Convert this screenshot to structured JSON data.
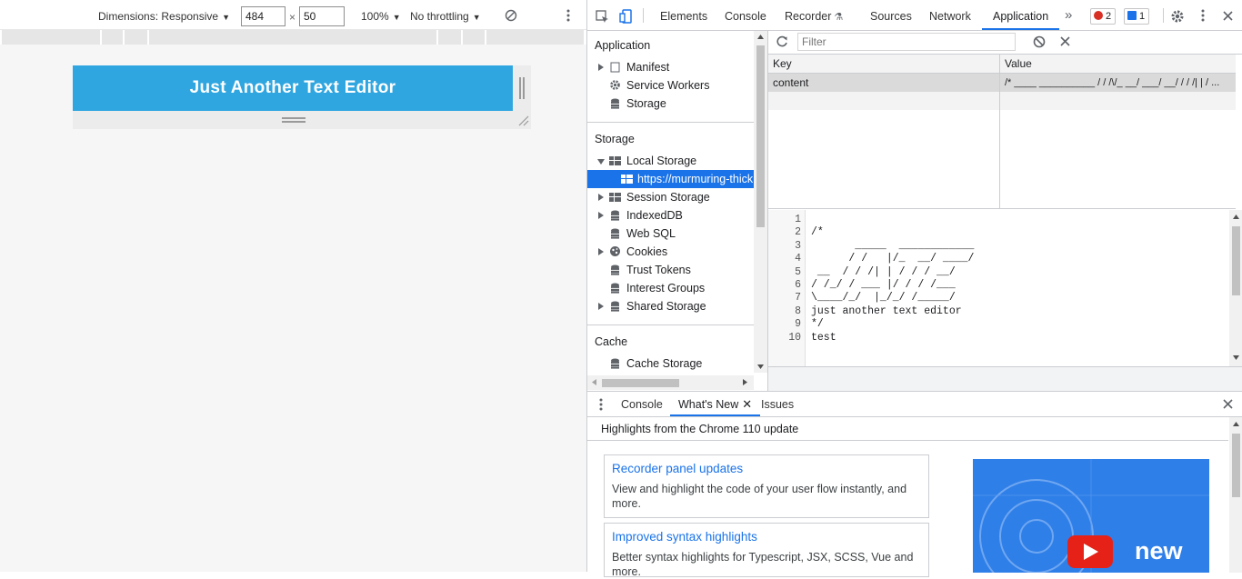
{
  "device_toolbar": {
    "dimensions_label": "Dimensions: Responsive",
    "width_value": "484",
    "times_sign": "×",
    "height_value": "50",
    "zoom_label": "100%",
    "throttle_label": "No throttling"
  },
  "page": {
    "app_title": "Just Another Text Editor",
    "accent_color": "#2fa6e0"
  },
  "devtools": {
    "tabs": [
      "Elements",
      "Console",
      "Recorder",
      "Sources",
      "Network",
      "Application"
    ],
    "active_tab": "Application",
    "more_tabs_glyph": "»",
    "error_count": "2",
    "message_count": "1",
    "sidebar": {
      "application_section": "Application",
      "application_items": [
        "Manifest",
        "Service Workers",
        "Storage"
      ],
      "storage_section": "Storage",
      "local_storage": "Local Storage",
      "local_storage_origin": "https://murmuring-thick",
      "storage_items": [
        "Session Storage",
        "IndexedDB",
        "Web SQL",
        "Cookies",
        "Trust Tokens",
        "Interest Groups",
        "Shared Storage"
      ],
      "cache_section": "Cache",
      "cache_items": [
        "Cache Storage"
      ]
    },
    "storage_table": {
      "filter_placeholder": "Filter",
      "key_header": "Key",
      "value_header": "Value",
      "rows": [
        {
          "key": "content",
          "value": "/*  ____  __________  / / /\\/_ __/ ___/ __/ / / /| | / ..."
        }
      ]
    },
    "preview": {
      "line_numbers": [
        "1",
        "2",
        "3",
        "4",
        "5",
        "6",
        "7",
        "8",
        "9",
        "10"
      ],
      "code": "\n/*\n       _____  ____________\n      / /   |/_  __/ ____/\n __  / / /| | / / / __/\n/ /_/ / ___ |/ / / /___\n\\____/_/  |_/_/ /_____/\njust another text editor\n*/\ntest"
    },
    "drawer": {
      "tabs": [
        "Console",
        "What's New",
        "Issues"
      ],
      "active_tab": "What's New",
      "highlights_title": "Highlights from the Chrome 110 update",
      "cards": [
        {
          "title": "Recorder panel updates",
          "desc": "View and highlight the code of your user flow instantly, and more."
        },
        {
          "title": "Improved syntax highlights",
          "desc": "Better syntax highlights for Typescript, JSX, SCSS, Vue and more."
        }
      ],
      "video_word": "new"
    }
  }
}
